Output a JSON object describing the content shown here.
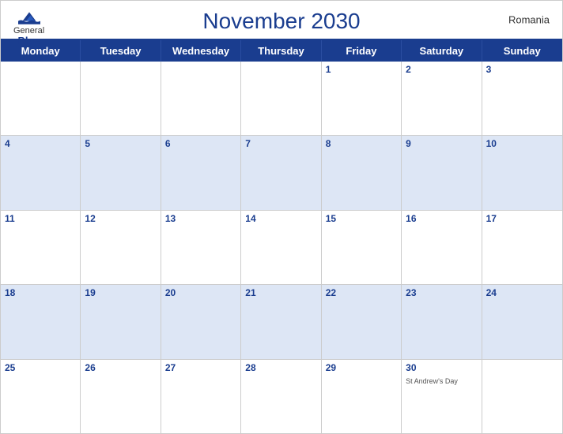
{
  "header": {
    "title": "November 2030",
    "country": "Romania",
    "logo": {
      "general": "General",
      "blue": "Blue"
    }
  },
  "dayHeaders": [
    "Monday",
    "Tuesday",
    "Wednesday",
    "Thursday",
    "Friday",
    "Saturday",
    "Sunday"
  ],
  "weeks": [
    {
      "shaded": false,
      "days": [
        {
          "num": "",
          "event": ""
        },
        {
          "num": "",
          "event": ""
        },
        {
          "num": "",
          "event": ""
        },
        {
          "num": "",
          "event": ""
        },
        {
          "num": "1",
          "event": ""
        },
        {
          "num": "2",
          "event": ""
        },
        {
          "num": "3",
          "event": ""
        }
      ]
    },
    {
      "shaded": true,
      "days": [
        {
          "num": "4",
          "event": ""
        },
        {
          "num": "5",
          "event": ""
        },
        {
          "num": "6",
          "event": ""
        },
        {
          "num": "7",
          "event": ""
        },
        {
          "num": "8",
          "event": ""
        },
        {
          "num": "9",
          "event": ""
        },
        {
          "num": "10",
          "event": ""
        }
      ]
    },
    {
      "shaded": false,
      "days": [
        {
          "num": "11",
          "event": ""
        },
        {
          "num": "12",
          "event": ""
        },
        {
          "num": "13",
          "event": ""
        },
        {
          "num": "14",
          "event": ""
        },
        {
          "num": "15",
          "event": ""
        },
        {
          "num": "16",
          "event": ""
        },
        {
          "num": "17",
          "event": ""
        }
      ]
    },
    {
      "shaded": true,
      "days": [
        {
          "num": "18",
          "event": ""
        },
        {
          "num": "19",
          "event": ""
        },
        {
          "num": "20",
          "event": ""
        },
        {
          "num": "21",
          "event": ""
        },
        {
          "num": "22",
          "event": ""
        },
        {
          "num": "23",
          "event": ""
        },
        {
          "num": "24",
          "event": ""
        }
      ]
    },
    {
      "shaded": false,
      "days": [
        {
          "num": "25",
          "event": ""
        },
        {
          "num": "26",
          "event": ""
        },
        {
          "num": "27",
          "event": ""
        },
        {
          "num": "28",
          "event": ""
        },
        {
          "num": "29",
          "event": ""
        },
        {
          "num": "30",
          "event": "St Andrew's Day"
        },
        {
          "num": "",
          "event": ""
        }
      ]
    }
  ],
  "colors": {
    "headerBg": "#1a3d8f",
    "headerText": "#ffffff",
    "titleColor": "#1a3d8f",
    "shadedRow": "#dde6f5",
    "dayNumberColor": "#1a3d8f"
  }
}
